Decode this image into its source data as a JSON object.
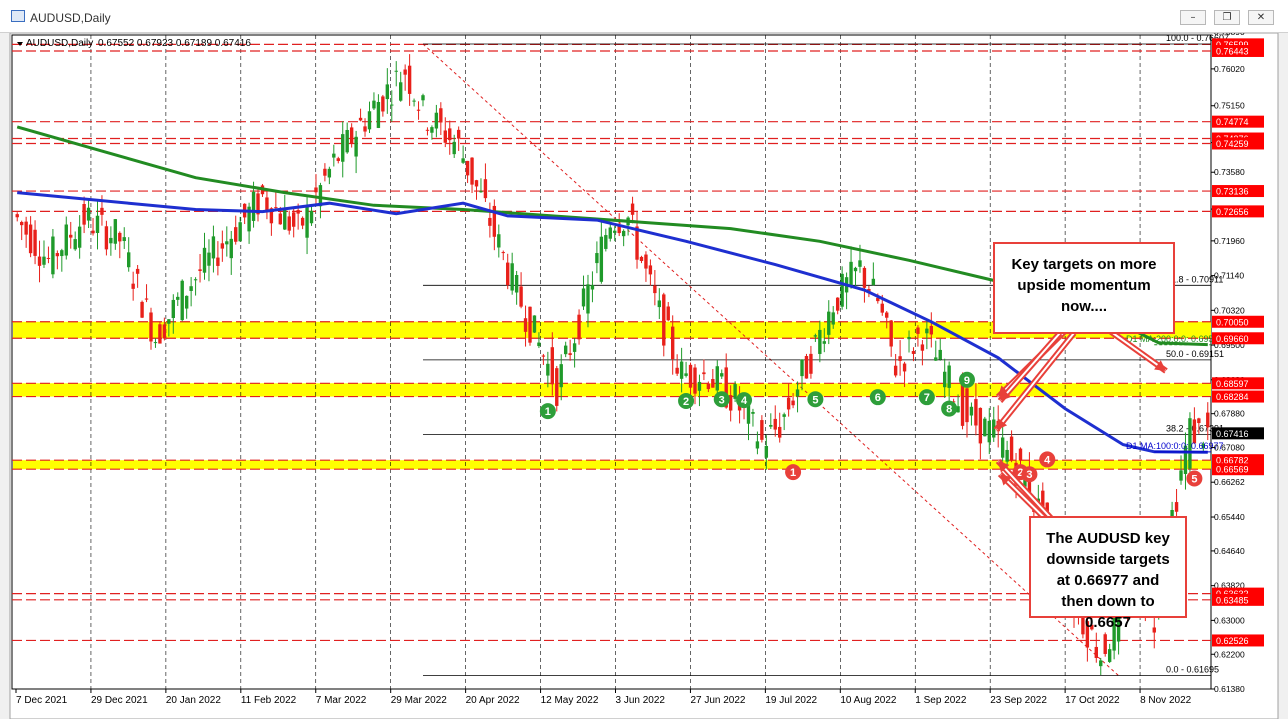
{
  "window": {
    "title": "AUDUSD,Daily",
    "minimize_label": "–",
    "restore_label": "❐",
    "close_label": "✕"
  },
  "header": {
    "symbol_text": "AUDUSD,Daily",
    "ohlc_text": "0.67552 0.67923 0.67189 0.67416"
  },
  "chart_data": {
    "type": "candlestick",
    "symbol": "AUDUSD",
    "timeframe": "Daily",
    "ohlc": {
      "open": 0.67552,
      "high": 0.67923,
      "low": 0.67189,
      "close": 0.67416
    },
    "ylim": [
      0.6138,
      0.7682
    ],
    "x_tick_labels": [
      "7 Dec 2021",
      "29 Dec 2021",
      "20 Jan 2022",
      "11 Feb 2022",
      "7 Mar 2022",
      "29 Mar 2022",
      "20 Apr 2022",
      "12 May 2022",
      "3 Jun 2022",
      "27 Jun 2022",
      "19 Jul 2022",
      "10 Aug 2022",
      "1 Sep 2022",
      "23 Sep 2022",
      "17 Oct 2022",
      "8 Nov 2022"
    ],
    "y_tick_labels": [
      "0.76890",
      "0.76020",
      "0.75150",
      "0.74280",
      "0.73580",
      "0.72710",
      "0.71960",
      "0.71140",
      "0.70320",
      "0.69500",
      "0.68680",
      "0.67880",
      "0.67080",
      "0.66262",
      "0.65440",
      "0.64640",
      "0.63820",
      "0.63000",
      "0.62200",
      "0.61380"
    ],
    "price_tags": [
      {
        "text": "0.76599",
        "value": 0.76599,
        "color": "#ff0000"
      },
      {
        "text": "0.76443",
        "value": 0.76443,
        "color": "#ff0000"
      },
      {
        "text": "0.74774",
        "value": 0.74774,
        "color": "#ff0000"
      },
      {
        "text": "0.74376",
        "value": 0.74376,
        "color": "#ff0000"
      },
      {
        "text": "0.74259",
        "value": 0.74259,
        "color": "#ff0000"
      },
      {
        "text": "0.73136",
        "value": 0.73136,
        "color": "#ff0000"
      },
      {
        "text": "0.72656",
        "value": 0.72656,
        "color": "#ff0000"
      },
      {
        "text": "0.70050",
        "value": 0.7005,
        "color": "#ff0000"
      },
      {
        "text": "0.69660",
        "value": 0.6966,
        "color": "#ff0000"
      },
      {
        "text": "0.68597",
        "value": 0.68597,
        "color": "#ff0000"
      },
      {
        "text": "0.68284",
        "value": 0.68284,
        "color": "#ff0000"
      },
      {
        "text": "0.67416",
        "value": 0.67416,
        "color": "#000000"
      },
      {
        "text": "0.66782",
        "value": 0.66782,
        "color": "#ff0000"
      },
      {
        "text": "0.66569",
        "value": 0.66569,
        "color": "#ff0000"
      },
      {
        "text": "0.63632",
        "value": 0.63632,
        "color": "#ff0000"
      },
      {
        "text": "0.63485",
        "value": 0.63485,
        "color": "#ff0000"
      },
      {
        "text": "0.62526",
        "value": 0.62526,
        "color": "#ff0000"
      }
    ],
    "support_resistance_levels": [
      0.76599,
      0.76443,
      0.74774,
      0.74376,
      0.74259,
      0.73136,
      0.72656,
      0.7005,
      0.6966,
      0.68597,
      0.68284,
      0.66782,
      0.66569,
      0.63632,
      0.63485,
      0.62526
    ],
    "zones": [
      {
        "from": 0.6966,
        "to": 0.7005,
        "color": "#ffff00"
      },
      {
        "from": 0.68284,
        "to": 0.68597,
        "color": "#ffff00"
      },
      {
        "from": 0.66569,
        "to": 0.66782,
        "color": "#ffff00"
      }
    ],
    "fibonacci": {
      "high": 0.76607,
      "low": 0.61695,
      "levels": [
        {
          "label": "100.0 - 0.76607",
          "value": 0.76607
        },
        {
          "label": "61.8 - 0.70911",
          "value": 0.70911
        },
        {
          "label": "50.0 - 0.69151",
          "value": 0.69151
        },
        {
          "label": "38.2 - 0.67391",
          "value": 0.67391
        },
        {
          "label": "0.0 - 0.61695",
          "value": 0.61695
        }
      ]
    },
    "ma_labels": [
      {
        "text": "D1 MA:200:0:0: 0.69506",
        "value": 0.69506,
        "color": "#228b22"
      },
      {
        "text": "D1 MA:100:0:0: 0.66977",
        "value": 0.66977,
        "color": "#0000cd"
      }
    ],
    "ma200": [
      [
        0,
        0.7465
      ],
      [
        20,
        0.7405
      ],
      [
        40,
        0.7345
      ],
      [
        60,
        0.731
      ],
      [
        80,
        0.728
      ],
      [
        100,
        0.727
      ],
      [
        120,
        0.7255
      ],
      [
        140,
        0.724
      ],
      [
        160,
        0.7225
      ],
      [
        180,
        0.7195
      ],
      [
        200,
        0.715
      ],
      [
        220,
        0.71
      ],
      [
        240,
        0.704
      ],
      [
        256,
        0.6955
      ],
      [
        267,
        0.6951
      ]
    ],
    "ma100": [
      [
        0,
        0.731
      ],
      [
        25,
        0.7285
      ],
      [
        40,
        0.727
      ],
      [
        55,
        0.7265
      ],
      [
        70,
        0.7285
      ],
      [
        85,
        0.726
      ],
      [
        100,
        0.7285
      ],
      [
        110,
        0.7255
      ],
      [
        130,
        0.7245
      ],
      [
        150,
        0.7195
      ],
      [
        170,
        0.714
      ],
      [
        190,
        0.708
      ],
      [
        205,
        0.7005
      ],
      [
        220,
        0.692
      ],
      [
        235,
        0.68
      ],
      [
        248,
        0.6715
      ],
      [
        255,
        0.6698
      ],
      [
        267,
        0.6697
      ]
    ],
    "close_path": [
      [
        0,
        0.726
      ],
      [
        8,
        0.715
      ],
      [
        16,
        0.725
      ],
      [
        24,
        0.72
      ],
      [
        32,
        0.697
      ],
      [
        40,
        0.71
      ],
      [
        48,
        0.72
      ],
      [
        56,
        0.73
      ],
      [
        64,
        0.722
      ],
      [
        72,
        0.738
      ],
      [
        80,
        0.75
      ],
      [
        88,
        0.76
      ],
      [
        92,
        0.75
      ],
      [
        100,
        0.742
      ],
      [
        106,
        0.727
      ],
      [
        112,
        0.71
      ],
      [
        118,
        0.695
      ],
      [
        122,
        0.685
      ],
      [
        128,
        0.704
      ],
      [
        134,
        0.725
      ],
      [
        138,
        0.725
      ],
      [
        144,
        0.705
      ],
      [
        150,
        0.688
      ],
      [
        156,
        0.688
      ],
      [
        162,
        0.682
      ],
      [
        168,
        0.672
      ],
      [
        172,
        0.676
      ],
      [
        178,
        0.69
      ],
      [
        184,
        0.705
      ],
      [
        190,
        0.713
      ],
      [
        194,
        0.705
      ],
      [
        198,
        0.69
      ],
      [
        204,
        0.698
      ],
      [
        208,
        0.69
      ],
      [
        214,
        0.678
      ],
      [
        220,
        0.674
      ],
      [
        226,
        0.665
      ],
      [
        230,
        0.656
      ],
      [
        236,
        0.638
      ],
      [
        240,
        0.63
      ],
      [
        244,
        0.622
      ],
      [
        248,
        0.63
      ],
      [
        252,
        0.638
      ],
      [
        256,
        0.63
      ],
      [
        260,
        0.655
      ],
      [
        264,
        0.675
      ],
      [
        267,
        0.6742
      ]
    ],
    "upper_annotation": "Key targets on more upside momentum now....",
    "lower_annotation": "The AUDUSD key downside targets at 0.66977 and then down to 0.6657",
    "swing_markers": [
      {
        "label": "1",
        "color": "#2e9e3a",
        "bar": 119,
        "value": 0.6794
      },
      {
        "label": "2",
        "color": "#2e9e3a",
        "bar": 150,
        "value": 0.6818
      },
      {
        "label": "3",
        "color": "#2e9e3a",
        "bar": 158,
        "value": 0.6822
      },
      {
        "label": "4",
        "color": "#2e9e3a",
        "bar": 163,
        "value": 0.682
      },
      {
        "label": "5",
        "color": "#2e9e3a",
        "bar": 179,
        "value": 0.6822
      },
      {
        "label": "6",
        "color": "#2e9e3a",
        "bar": 193,
        "value": 0.6827
      },
      {
        "label": "7",
        "color": "#2e9e3a",
        "bar": 204,
        "value": 0.6827
      },
      {
        "label": "8",
        "color": "#2e9e3a",
        "bar": 209,
        "value": 0.68
      },
      {
        "label": "9",
        "color": "#2e9e3a",
        "bar": 213,
        "value": 0.6868
      },
      {
        "label": "1",
        "color": "#e8403a",
        "bar": 174,
        "value": 0.665
      },
      {
        "label": "2",
        "color": "#e8403a",
        "bar": 225,
        "value": 0.665
      },
      {
        "label": "3",
        "color": "#e8403a",
        "bar": 227,
        "value": 0.6645
      },
      {
        "label": "4",
        "color": "#e8403a",
        "bar": 231,
        "value": 0.668
      },
      {
        "label": "5",
        "color": "#e8403a",
        "bar": 264,
        "value": 0.6635
      }
    ]
  }
}
